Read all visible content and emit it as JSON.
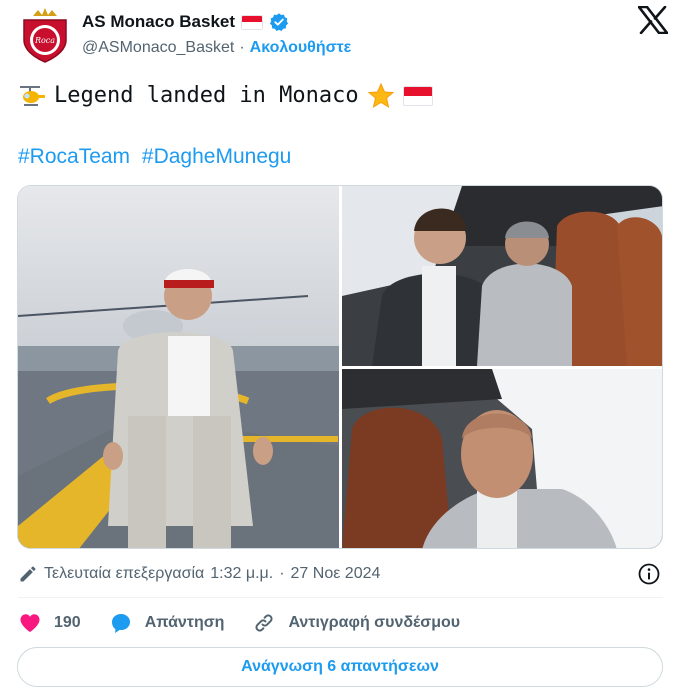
{
  "colors": {
    "accent": "#1d9bf0",
    "like": "#f91880",
    "text": "#0f1419",
    "muted": "#536471"
  },
  "header": {
    "display_name": "AS Monaco Basket",
    "handle": "@ASMonaco_Basket",
    "separator": "·",
    "follow_label": "Ακολουθήστε",
    "avatar_icon": "as-monaco-basket-logo",
    "verified_icon": "verified-badge-icon",
    "flag_icon": "monaco-flag-icon",
    "platform_icon": "x-logo-icon"
  },
  "tweet": {
    "text": "Legend landed in Monaco",
    "leading_emoji": "helicopter-emoji",
    "trailing_emojis": [
      "glowing-star-emoji",
      "monaco-flag-emoji"
    ],
    "hashtags": [
      "#RocaTeam",
      "#DagheMunegu"
    ]
  },
  "media": {
    "photos": [
      {
        "name": "man-on-helipad-photo"
      },
      {
        "name": "helicopter-passengers-photo"
      },
      {
        "name": "man-in-helicopter-photo"
      }
    ]
  },
  "meta": {
    "edited_label": "Τελευταία επεξεργασία",
    "time": "1:32 μ.μ.",
    "separator": "·",
    "date": "27 Νοε 2024"
  },
  "actions": {
    "like_count": "190",
    "reply_label": "Απάντηση",
    "copy_link_label": "Αντιγραφή συνδέσμου"
  },
  "read_replies_label": "Ανάγνωση 6 απαντήσεων"
}
